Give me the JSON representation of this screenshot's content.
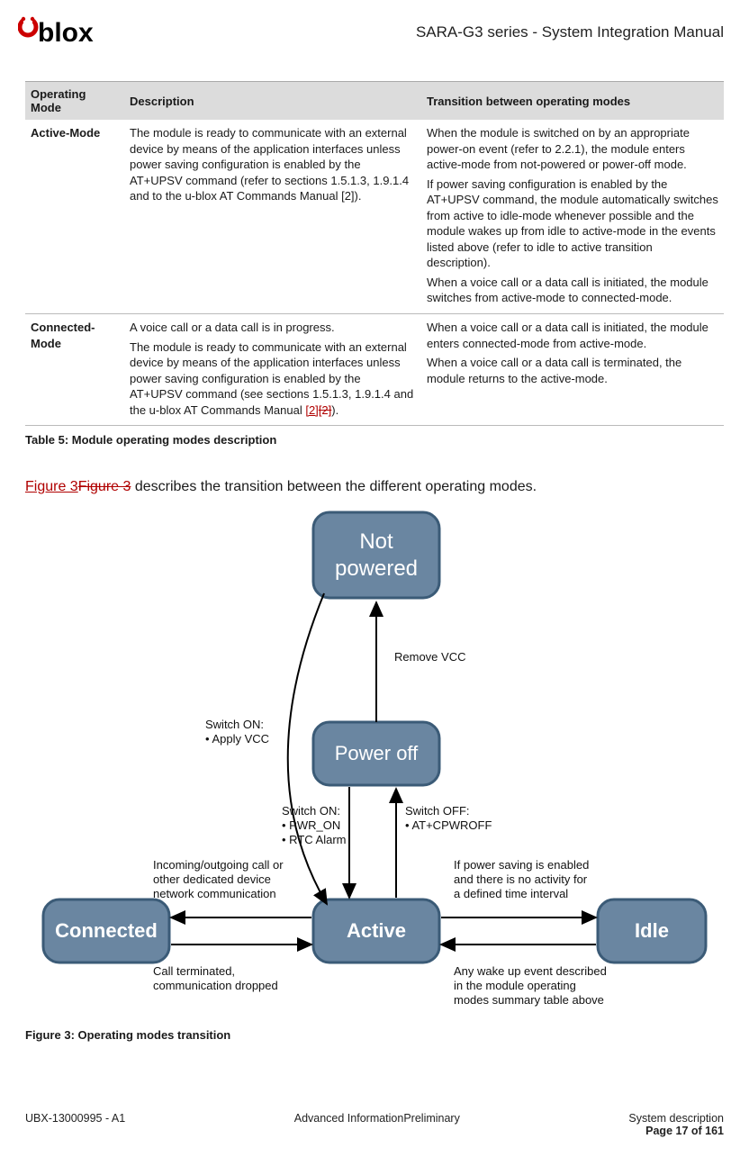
{
  "header": {
    "logo_text": "blox",
    "doc_title": "SARA-G3 series - System Integration Manual"
  },
  "table": {
    "headers": [
      "Operating Mode",
      "Description",
      "Transition between operating modes"
    ],
    "rows": [
      {
        "mode": "Active-Mode",
        "desc": "The module is ready to communicate with an external device by means of the application interfaces unless power saving configuration is enabled by the AT+UPSV command (refer to sections 1.5.1.3, 1.9.1.4 and to the u-blox AT Commands Manual [2]).",
        "trans_p1": "When the module is switched on by an appropriate power-on event (refer to 2.2.1), the module enters active-mode from not-powered or power-off mode.",
        "trans_p2": "If power saving configuration is enabled by the AT+UPSV command, the module automatically switches from active to idle-mode whenever possible and the module wakes up from idle to active-mode in the events listed above (refer to idle to active transition description).",
        "trans_p3": "When a voice call or a data call is initiated, the module switches from active-mode to connected-mode."
      },
      {
        "mode": "Connected-Mode",
        "desc_p1": "A voice call or a data call is in progress.",
        "desc_p2_pre": "The module is ready to communicate with an external device by means of the application interfaces unless power saving configuration is enabled by the AT+UPSV command (see sections 1.5.1.3, 1.9.1.4 and the u-blox AT Commands Manual ",
        "ref_a": "[2]",
        "ref_b": "[2]",
        "desc_p2_post": ").",
        "trans_p1": "When a voice call or a data call is initiated, the module enters connected-mode from active-mode.",
        "trans_p2": "When a voice call or a data call is terminated, the module returns to the active-mode."
      }
    ]
  },
  "caption_table": "Table 5: Module operating modes description",
  "body_line_pre": "Figure 3",
  "body_line_strike": "Figure 3",
  "body_line_post": " describes the transition between the different operating modes.",
  "caption_figure": "Figure 3: Operating modes transition",
  "diagram": {
    "nodes": {
      "not_powered_l1": "Not",
      "not_powered_l2": "powered",
      "power_off": "Power off",
      "connected": "Connected",
      "active": "Active",
      "idle": "Idle"
    },
    "labels": {
      "remove_vcc": "Remove VCC",
      "switch_on_vcc_l1": "Switch ON:",
      "switch_on_vcc_l2": "•  Apply VCC",
      "switch_on_pwr_l1": "Switch ON:",
      "switch_on_pwr_l2": "•  PWR_ON",
      "switch_on_pwr_l3": "•  RTC Alarm",
      "switch_off_l1": "Switch OFF:",
      "switch_off_l2": "•  AT+CPWROFF",
      "incoming_l1": "Incoming/outgoing call or",
      "incoming_l2": "other dedicated device",
      "incoming_l3": "network communication",
      "call_term_l1": "Call terminated,",
      "call_term_l2": "communication dropped",
      "pwr_save_l1": "If power saving is enabled",
      "pwr_save_l2": "and there is no activity for",
      "pwr_save_l3": "a defined time interval",
      "wake_l1": "Any wake up event described",
      "wake_l2": "in the module operating",
      "wake_l3": "modes summary table above"
    }
  },
  "footer": {
    "left": "UBX-13000995 - A1",
    "center": "Advanced InformationPreliminary",
    "right_top": "System description",
    "page": "Page 17 of 161"
  }
}
